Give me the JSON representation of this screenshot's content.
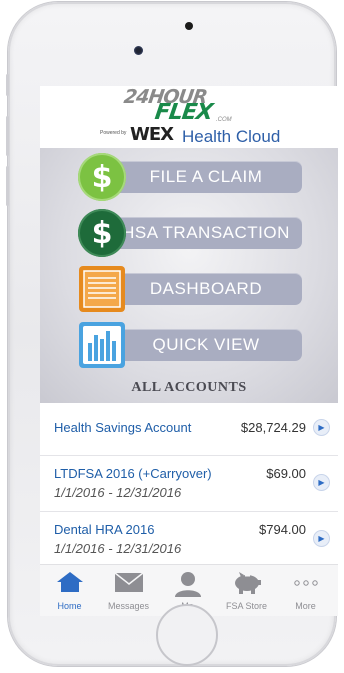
{
  "logo": {
    "line1": "24HOUR",
    "line2": "FLEX",
    "com": ".COM",
    "powered": "Powered by",
    "wex": "WEX",
    "health_cloud": "Health Cloud"
  },
  "menu": [
    {
      "label": "FILE A CLAIM",
      "icon": "dollar-icon",
      "color": "#7cc242"
    },
    {
      "label": "HSA TRANSACTION",
      "icon": "dollar-icon",
      "color": "#1e6b3a"
    },
    {
      "label": "DASHBOARD",
      "icon": "document-icon",
      "color": "#e68a1e"
    },
    {
      "label": "QUICK VIEW",
      "icon": "bar-chart-icon",
      "color": "#4aa3e0"
    }
  ],
  "all_accounts_heading": "ALL ACCOUNTS",
  "accounts": [
    {
      "name": "Health Savings Account",
      "amount": "$28,724.29",
      "dates": ""
    },
    {
      "name": "LTDFSA 2016 (+Carryover)",
      "amount": "$69.00",
      "dates": "1/1/2016 - 12/31/2016"
    },
    {
      "name": "Dental HRA 2016",
      "amount": "$794.00",
      "dates": "1/1/2016 - 12/31/2016"
    }
  ],
  "tabs": [
    {
      "label": "Home",
      "icon": "home-icon",
      "active": true
    },
    {
      "label": "Messages",
      "icon": "envelope-icon",
      "active": false
    },
    {
      "label": "Me",
      "icon": "person-icon",
      "active": false
    },
    {
      "label": "FSA Store",
      "icon": "piggy-bank-icon",
      "active": false
    },
    {
      "label": "More",
      "icon": "more-icon",
      "active": false
    }
  ],
  "colors": {
    "accent_blue": "#2e6cc4",
    "menu_button": "#a9adc1",
    "flex_green": "#1a8a4a"
  }
}
